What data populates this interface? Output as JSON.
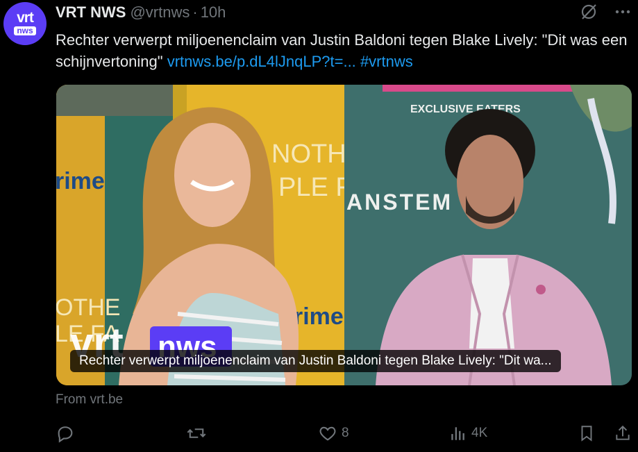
{
  "author": {
    "avatar_top": "vrt",
    "avatar_bottom": "nws",
    "name": "VRT NWS",
    "handle": "@vrtnws",
    "separator": "·",
    "time": "10h"
  },
  "tweet": {
    "text": "Rechter verwerpt miljoenenclaim van Justin Baldoni tegen Blake Lively: \"Dit was een schijnvertoning\"",
    "link": "vrtnws.be/p.dL4lJnqLP?t=...",
    "hashtag": "#vrtnws"
  },
  "card": {
    "caption": "Rechter verwerpt miljoenenclaim van Justin Baldoni tegen Blake Lively: \"Dit wa...",
    "source": "From vrt.be",
    "watermark_left": "vrt",
    "watermark_right": "nws",
    "backdrop_left_lines": [
      "NOTHI",
      "PLE FA"
    ],
    "backdrop_left_bottom": [
      "OTHE",
      "LE FA"
    ],
    "backdrop_brand": "rime",
    "backdrop_right_top": "EXCLUSIVE        EATERS",
    "backdrop_right_mid": "ANSTEM"
  },
  "actions": {
    "reply_count": "",
    "repost_count": "",
    "like_count": "8",
    "views_count": "4K"
  },
  "colors": {
    "background": "#000000",
    "text": "#e7e9ea",
    "muted": "#71767b",
    "link": "#1d9bf0",
    "avatar": "#5b3df5"
  },
  "icons": [
    "grok-icon",
    "more-icon",
    "reply-icon",
    "repost-icon",
    "like-icon",
    "views-icon",
    "bookmark-icon",
    "share-icon"
  ]
}
